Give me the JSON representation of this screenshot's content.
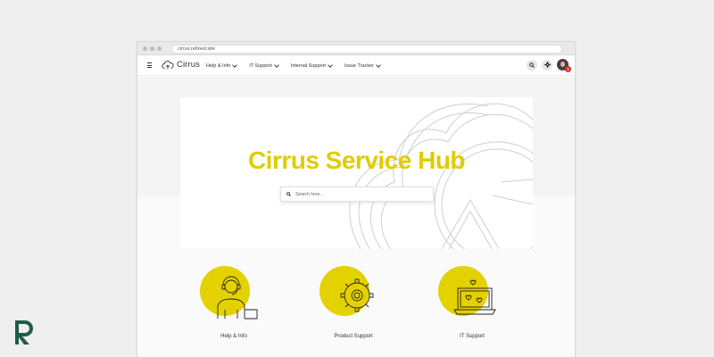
{
  "browser": {
    "url": "cirrus.refined.site"
  },
  "nav": {
    "brand": "Cirrus",
    "menu": [
      {
        "label": "Help & Info"
      },
      {
        "label": "IT Support"
      },
      {
        "label": "Internal Support"
      },
      {
        "label": "Issue Tracker"
      }
    ],
    "notification_count": "1"
  },
  "hero": {
    "title": "Cirrus Service Hub",
    "search_placeholder": "Search here..."
  },
  "cards": [
    {
      "label": "Help & Info",
      "icon": "support-agent-icon"
    },
    {
      "label": "Product Support",
      "icon": "gear-icon"
    },
    {
      "label": "IT Support",
      "icon": "laptop-icon"
    }
  ],
  "colors": {
    "accent": "#e4d100",
    "hero_text": "#e0cc00",
    "background": "#efefef",
    "brand_mark": "#1f5c48",
    "notification": "#e0332b"
  }
}
